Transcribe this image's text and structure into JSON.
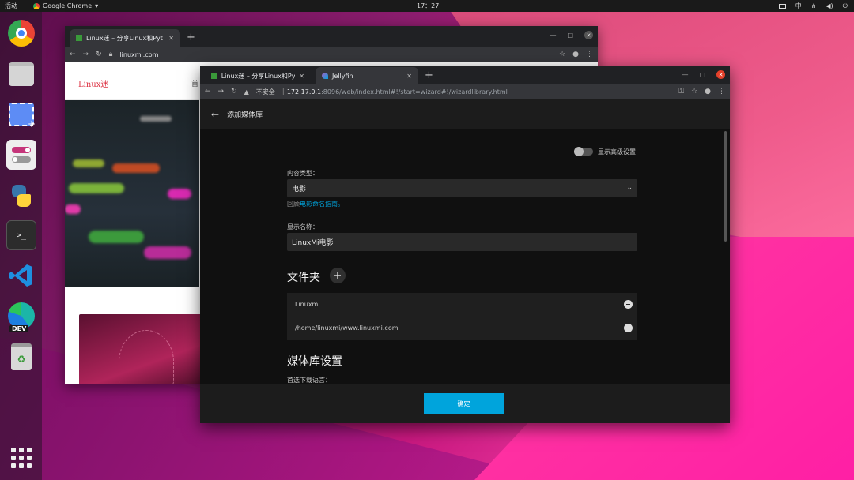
{
  "topbar": {
    "activities": "活动",
    "app": "Google Chrome",
    "clock": "17：27",
    "input_method": "中"
  },
  "dock": {
    "items": [
      "chrome-icon",
      "files-icon",
      "screenshot-icon",
      "toggle-settings-icon",
      "python-icon",
      "terminal-icon",
      "vscode-icon",
      "edge-dev-icon",
      "trash-icon"
    ],
    "edge_badge": "DEV"
  },
  "window1": {
    "tab_title": "Linux迷 – 分享Linux和Pyt",
    "url": "linuxmi.com",
    "logo": "Linux迷",
    "nav_first": "首"
  },
  "window2": {
    "tabs": [
      {
        "title": "Linux迷 – 分享Linux和Pyt"
      },
      {
        "title": "Jellyfin"
      }
    ],
    "address": {
      "security": "不安全",
      "host": "172.17.0.1",
      "path": ":8096/web/index.html#!/start=wizard#!/wizardlibrary.html"
    },
    "header_title": "添加媒体库",
    "advanced_toggle_label": "显示高级设置",
    "content_type_label": "内容类型：",
    "content_type_value": "电影",
    "help_prefix": "回顾",
    "help_link": "电影命名指南。",
    "display_name_label": "显示名称：",
    "display_name_value": "LinuxMi电影",
    "folders_heading": "文件夹",
    "folders": [
      {
        "path": "Linuxmi"
      },
      {
        "path": "/home/linuxmi/www.linuxmi.com"
      }
    ],
    "library_settings_heading": "媒体库设置",
    "partial_label": "首选下载语言：",
    "ok_button": "确定"
  },
  "colors": {
    "accent": "#00a4dc"
  }
}
